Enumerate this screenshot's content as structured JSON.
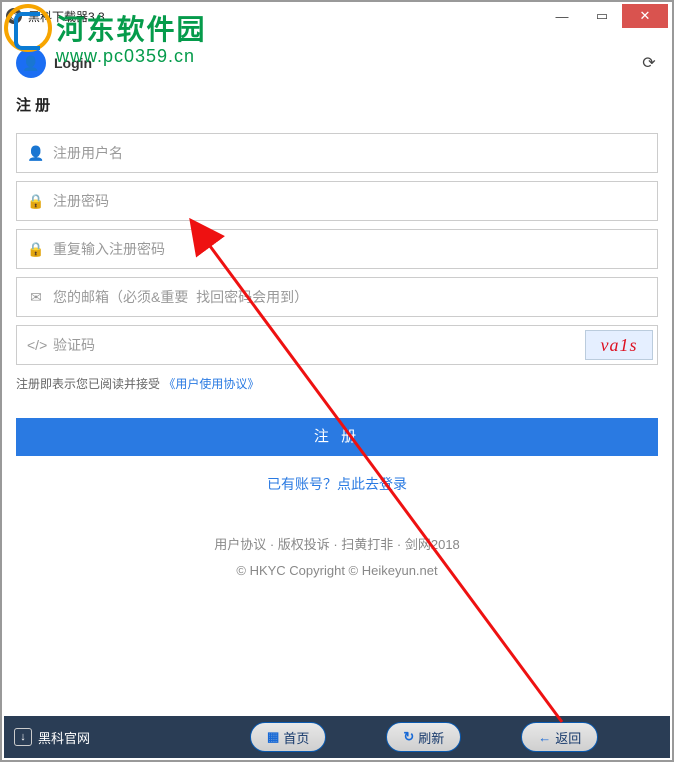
{
  "titlebar": {
    "title": "黑科下载器3.3"
  },
  "watermark": {
    "cn": "河东软件园",
    "url": "www.pc0359.cn"
  },
  "header": {
    "login_label": "Login"
  },
  "form": {
    "title": "注 册",
    "username_ph": "注册用户名",
    "password_ph": "注册密码",
    "password2_ph": "重复输入注册密码",
    "email_ph": "您的邮箱（必须&重要  找回密码会用到）",
    "captcha_ph": "验证码",
    "captcha_text": "va1s"
  },
  "agreement": {
    "prefix": "注册即表示您已阅读并接受",
    "link": "《用户使用协议》"
  },
  "buttons": {
    "submit": "注 册",
    "login_link": "已有账号？点此去登录"
  },
  "footer": {
    "links": "用户协议 · 版权投诉 · 扫黄打非 · 剑网2018",
    "copyright": "©  HKYC  Copyright © Heikeyun.net"
  },
  "bottombar": {
    "official": "黑科官网",
    "home": "首页",
    "refresh": "刷新",
    "back": "返回"
  }
}
